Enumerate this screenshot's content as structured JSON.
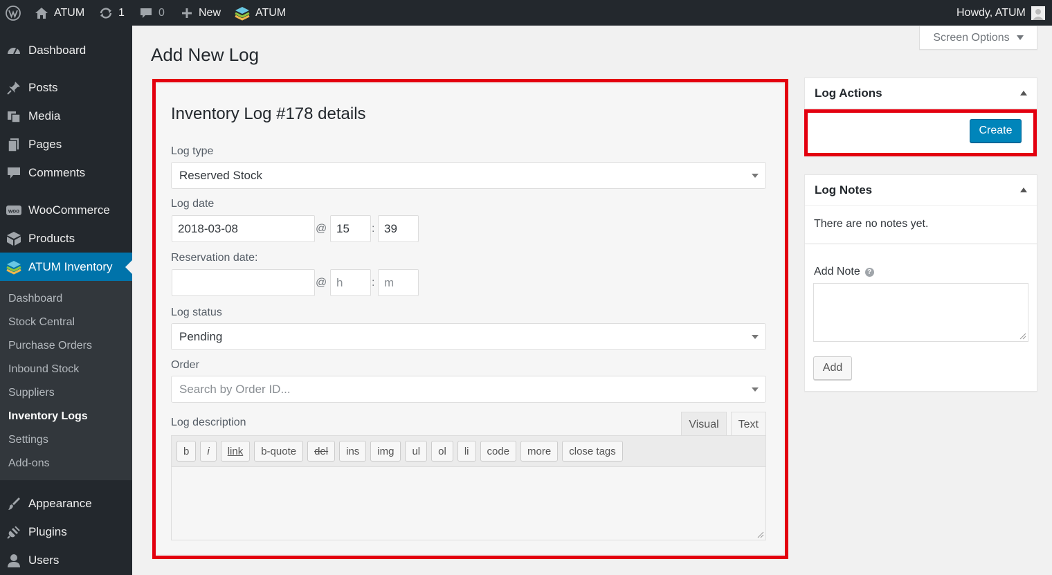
{
  "adminbar": {
    "site_name": "ATUM",
    "updates_count": "1",
    "comments_count": "0",
    "new_label": "New",
    "plugin_label": "ATUM",
    "howdy": "Howdy, ATUM"
  },
  "sidebar": {
    "items": [
      {
        "label": "Dashboard",
        "icon": "dashboard-icon"
      },
      {
        "label": "Posts",
        "icon": "pin-icon"
      },
      {
        "label": "Media",
        "icon": "media-icon"
      },
      {
        "label": "Pages",
        "icon": "pages-icon"
      },
      {
        "label": "Comments",
        "icon": "comment-icon"
      },
      {
        "label": "WooCommerce",
        "icon": "woo-icon"
      },
      {
        "label": "Products",
        "icon": "box-icon"
      },
      {
        "label": "ATUM Inventory",
        "icon": "atum-icon"
      },
      {
        "label": "Appearance",
        "icon": "brush-icon"
      },
      {
        "label": "Plugins",
        "icon": "plug-icon"
      },
      {
        "label": "Users",
        "icon": "user-icon"
      }
    ],
    "submenu": [
      "Dashboard",
      "Stock Central",
      "Purchase Orders",
      "Inbound Stock",
      "Suppliers",
      "Inventory Logs",
      "Settings",
      "Add-ons"
    ]
  },
  "screen_options": "Screen Options",
  "page_title": "Add New Log",
  "log": {
    "heading": "Inventory Log #178 details",
    "type_label": "Log type",
    "type_value": "Reserved Stock",
    "date_label": "Log date",
    "date_value": "2018-03-08",
    "hour": "15",
    "minute": "39",
    "at": "@",
    "colon": ":",
    "reservation_label": "Reservation date:",
    "hour_placeholder": "h",
    "minute_placeholder": "m",
    "status_label": "Log status",
    "status_value": "Pending",
    "order_label": "Order",
    "order_placeholder": "Search by Order ID...",
    "description_label": "Log description",
    "tabs": {
      "visual": "Visual",
      "text": "Text"
    },
    "toolbar": [
      "b",
      "i",
      "link",
      "b-quote",
      "del",
      "ins",
      "img",
      "ul",
      "ol",
      "li",
      "code",
      "more",
      "close tags"
    ]
  },
  "actions_box": {
    "title": "Log Actions",
    "create": "Create"
  },
  "notes_box": {
    "title": "Log Notes",
    "empty": "There are no notes yet.",
    "add_note_label": "Add Note",
    "help": "?",
    "add_button": "Add"
  },
  "colors": {
    "accent": "#0073aa",
    "primary_button": "#0085ba",
    "highlight": "#e3000f",
    "sidebar_bg": "#23282d",
    "submenu_bg": "#32373c"
  }
}
